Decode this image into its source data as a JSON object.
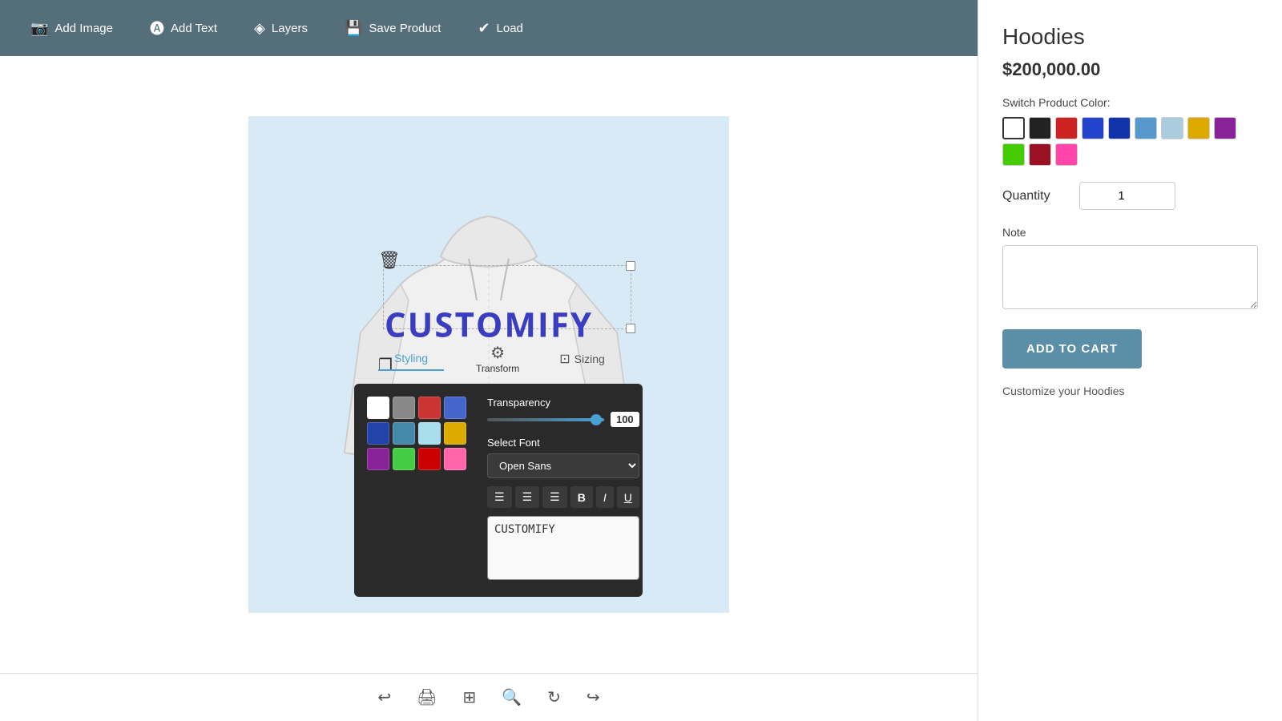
{
  "toolbar": {
    "add_image_label": "Add Image",
    "add_text_label": "Add Text",
    "layers_label": "Layers",
    "save_product_label": "Save Product",
    "load_label": "Load"
  },
  "canvas": {
    "customify_text": "CUSTOMIFY"
  },
  "text_editor": {
    "tab_styling": "Styling",
    "tab_sizing": "Sizing",
    "tab_transform": "Transform",
    "transparency_label": "Transparency",
    "transparency_value": "100",
    "select_font_label": "Select Font",
    "font_value": "Open Sans",
    "text_content": "CUSTOMIFY",
    "colors": [
      "#ffffff",
      "#888888",
      "#cc3333",
      "#4466cc",
      "#2244aa",
      "#4488aa",
      "#aaddee",
      "#ddaa00",
      "#882299",
      "#44cc44",
      "#cc0000",
      "#ff66aa"
    ],
    "fmt_align_left": "≡",
    "fmt_align_center": "≡",
    "fmt_align_right": "≡",
    "fmt_bold": "B",
    "fmt_italic": "I",
    "fmt_underline": "U"
  },
  "product": {
    "title": "Hoodies",
    "price": "$200,000.00",
    "color_label": "Switch Product Color:",
    "colors": [
      {
        "hex": "#ffffff",
        "label": "white"
      },
      {
        "hex": "#222222",
        "label": "black"
      },
      {
        "hex": "#cc2222",
        "label": "red"
      },
      {
        "hex": "#2244cc",
        "label": "blue"
      },
      {
        "hex": "#1133aa",
        "label": "dark-blue"
      },
      {
        "hex": "#5599cc",
        "label": "light-blue"
      },
      {
        "hex": "#aaccdd",
        "label": "sky"
      },
      {
        "hex": "#ddaa00",
        "label": "yellow"
      },
      {
        "hex": "#882299",
        "label": "purple"
      },
      {
        "hex": "#44cc00",
        "label": "green"
      },
      {
        "hex": "#991122",
        "label": "dark-red"
      },
      {
        "hex": "#ff44aa",
        "label": "pink"
      }
    ],
    "quantity_label": "Quantity",
    "quantity_value": "1",
    "note_label": "Note",
    "add_to_cart_label": "ADD TO CART",
    "customize_note": "Customize your Hoodies"
  },
  "bottom_toolbar": {
    "undo": "↩",
    "print": "🖨",
    "grid": "⊞",
    "zoom": "🔍",
    "refresh": "↻",
    "redo": "↪"
  }
}
